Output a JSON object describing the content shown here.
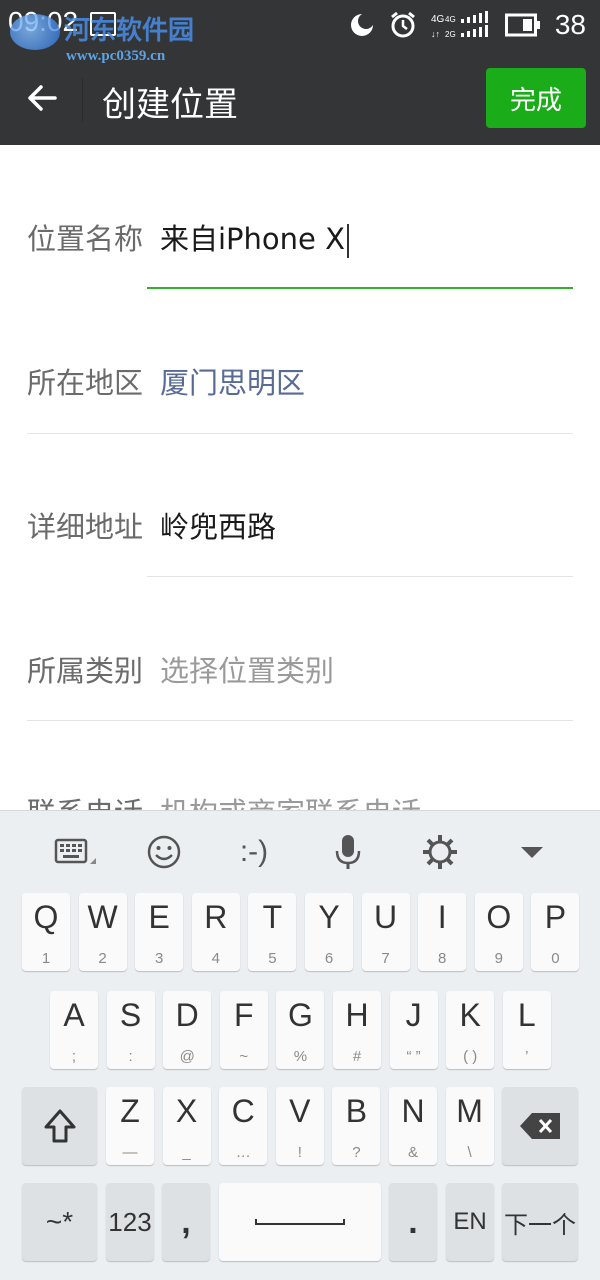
{
  "status_bar": {
    "time": "09:02",
    "watermark_title": "河东软件园",
    "watermark_url": "www.pc0359.cn",
    "network_label": "4G",
    "battery_level": "38"
  },
  "app_bar": {
    "title": "创建位置",
    "done_label": "完成"
  },
  "form": {
    "name": {
      "label": "位置名称",
      "value": "来自iPhone X"
    },
    "region": {
      "label": "所在地区",
      "value": "厦门思明区"
    },
    "address": {
      "label": "详细地址",
      "value": "岭兜西路"
    },
    "category": {
      "label": "所属类别",
      "placeholder": "选择位置类别"
    },
    "phone": {
      "label": "联系电话",
      "placeholder": "机构或商家联系电话"
    }
  },
  "keyboard": {
    "toolbar": [
      "keyboard-icon",
      "emoji-icon",
      "emoticon-icon",
      "microphone-icon",
      "settings-icon",
      "hide-keyboard-icon"
    ],
    "emoticon_text": ":-)",
    "row1": [
      {
        "main": "Q",
        "sub": "1"
      },
      {
        "main": "W",
        "sub": "2"
      },
      {
        "main": "E",
        "sub": "3"
      },
      {
        "main": "R",
        "sub": "4"
      },
      {
        "main": "T",
        "sub": "5"
      },
      {
        "main": "Y",
        "sub": "6"
      },
      {
        "main": "U",
        "sub": "7"
      },
      {
        "main": "I",
        "sub": "8"
      },
      {
        "main": "O",
        "sub": "9"
      },
      {
        "main": "P",
        "sub": "0"
      }
    ],
    "row2": [
      {
        "main": "A",
        "sub": ";"
      },
      {
        "main": "S",
        "sub": ":"
      },
      {
        "main": "D",
        "sub": "@"
      },
      {
        "main": "F",
        "sub": "~"
      },
      {
        "main": "G",
        "sub": "%"
      },
      {
        "main": "H",
        "sub": "#"
      },
      {
        "main": "J",
        "sub": "“ ”"
      },
      {
        "main": "K",
        "sub": "( )"
      },
      {
        "main": "L",
        "sub": "’"
      }
    ],
    "row3": [
      {
        "main": "Z",
        "sub": "—"
      },
      {
        "main": "X",
        "sub": "_"
      },
      {
        "main": "C",
        "sub": "…"
      },
      {
        "main": "V",
        "sub": "!"
      },
      {
        "main": "B",
        "sub": "?"
      },
      {
        "main": "N",
        "sub": "&"
      },
      {
        "main": "M",
        "sub": "\\"
      }
    ],
    "row4": {
      "symbols": "~*",
      "numbers": "123",
      "comma": ",",
      "period": ".",
      "language": "EN",
      "next": "下一个"
    }
  },
  "colors": {
    "bar_bg": "#333537",
    "accent_green": "#1aad19",
    "link_blue": "#576b95"
  }
}
